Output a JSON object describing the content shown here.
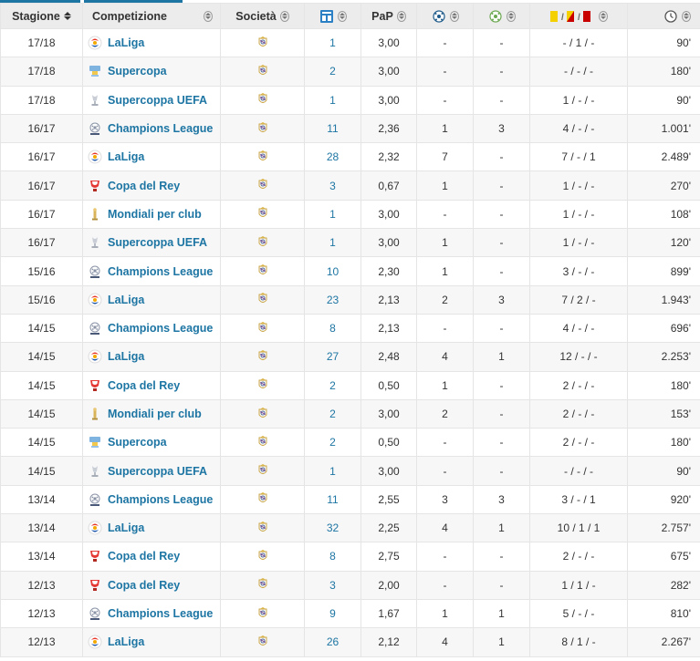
{
  "headers": {
    "season": "Stagione",
    "competition": "Competizione",
    "club": "Società",
    "appearances_icon": "appearances-icon",
    "ppg": "PaP",
    "goals_icon": "goals-icon",
    "assists_icon": "assists-icon",
    "cards_icon": "cards-icon",
    "minutes_icon": "clock-icon"
  },
  "colors": {
    "link": "#1d75a3",
    "header_bg": "#ececec",
    "row_alt": "#f7f7f7",
    "yellow_card": "#f5d000",
    "red_card": "#c90000"
  },
  "rows": [
    {
      "season": "17/18",
      "competition": "LaLiga",
      "icon": "laliga-icon",
      "club_icon": "real-madrid-crest-icon",
      "apps": "1",
      "ppg": "3,00",
      "goals": "-",
      "assists": "-",
      "cards": "- / 1 / -",
      "minutes": "90'"
    },
    {
      "season": "17/18",
      "competition": "Supercopa",
      "icon": "supercopa-icon",
      "club_icon": "real-madrid-crest-icon",
      "apps": "2",
      "ppg": "3,00",
      "goals": "-",
      "assists": "-",
      "cards": "- / - / -",
      "minutes": "180'"
    },
    {
      "season": "17/18",
      "competition": "Supercoppa UEFA",
      "icon": "uefa-supercup-icon",
      "club_icon": "real-madrid-crest-icon",
      "apps": "1",
      "ppg": "3,00",
      "goals": "-",
      "assists": "-",
      "cards": "1 / - / -",
      "minutes": "90'"
    },
    {
      "season": "16/17",
      "competition": "Champions League",
      "icon": "champions-league-icon",
      "club_icon": "real-madrid-crest-icon",
      "apps": "11",
      "ppg": "2,36",
      "goals": "1",
      "assists": "3",
      "cards": "4 / - / -",
      "minutes": "1.001'"
    },
    {
      "season": "16/17",
      "competition": "LaLiga",
      "icon": "laliga-icon",
      "club_icon": "real-madrid-crest-icon",
      "apps": "28",
      "ppg": "2,32",
      "goals": "7",
      "assists": "-",
      "cards": "7 / - / 1",
      "minutes": "2.489'"
    },
    {
      "season": "16/17",
      "competition": "Copa del Rey",
      "icon": "copa-del-rey-icon",
      "club_icon": "real-madrid-crest-icon",
      "apps": "3",
      "ppg": "0,67",
      "goals": "1",
      "assists": "-",
      "cards": "1 / - / -",
      "minutes": "270'"
    },
    {
      "season": "16/17",
      "competition": "Mondiali per club",
      "icon": "club-world-cup-icon",
      "club_icon": "real-madrid-crest-icon",
      "apps": "1",
      "ppg": "3,00",
      "goals": "-",
      "assists": "-",
      "cards": "1 / - / -",
      "minutes": "108'"
    },
    {
      "season": "16/17",
      "competition": "Supercoppa UEFA",
      "icon": "uefa-supercup-icon",
      "club_icon": "real-madrid-crest-icon",
      "apps": "1",
      "ppg": "3,00",
      "goals": "1",
      "assists": "-",
      "cards": "1 / - / -",
      "minutes": "120'"
    },
    {
      "season": "15/16",
      "competition": "Champions League",
      "icon": "champions-league-icon",
      "club_icon": "real-madrid-crest-icon",
      "apps": "10",
      "ppg": "2,30",
      "goals": "1",
      "assists": "-",
      "cards": "3 / - / -",
      "minutes": "899'"
    },
    {
      "season": "15/16",
      "competition": "LaLiga",
      "icon": "laliga-icon",
      "club_icon": "real-madrid-crest-icon",
      "apps": "23",
      "ppg": "2,13",
      "goals": "2",
      "assists": "3",
      "cards": "7 / 2 / -",
      "minutes": "1.943'"
    },
    {
      "season": "14/15",
      "competition": "Champions League",
      "icon": "champions-league-icon",
      "club_icon": "real-madrid-crest-icon",
      "apps": "8",
      "ppg": "2,13",
      "goals": "-",
      "assists": "-",
      "cards": "4 / - / -",
      "minutes": "696'"
    },
    {
      "season": "14/15",
      "competition": "LaLiga",
      "icon": "laliga-icon",
      "club_icon": "real-madrid-crest-icon",
      "apps": "27",
      "ppg": "2,48",
      "goals": "4",
      "assists": "1",
      "cards": "12 / - / -",
      "minutes": "2.253'"
    },
    {
      "season": "14/15",
      "competition": "Copa del Rey",
      "icon": "copa-del-rey-icon",
      "club_icon": "real-madrid-crest-icon",
      "apps": "2",
      "ppg": "0,50",
      "goals": "1",
      "assists": "-",
      "cards": "2 / - / -",
      "minutes": "180'"
    },
    {
      "season": "14/15",
      "competition": "Mondiali per club",
      "icon": "club-world-cup-icon",
      "club_icon": "real-madrid-crest-icon",
      "apps": "2",
      "ppg": "3,00",
      "goals": "2",
      "assists": "-",
      "cards": "2 / - / -",
      "minutes": "153'"
    },
    {
      "season": "14/15",
      "competition": "Supercopa",
      "icon": "supercopa-icon",
      "club_icon": "real-madrid-crest-icon",
      "apps": "2",
      "ppg": "0,50",
      "goals": "-",
      "assists": "-",
      "cards": "2 / - / -",
      "minutes": "180'"
    },
    {
      "season": "14/15",
      "competition": "Supercoppa UEFA",
      "icon": "uefa-supercup-icon",
      "club_icon": "real-madrid-crest-icon",
      "apps": "1",
      "ppg": "3,00",
      "goals": "-",
      "assists": "-",
      "cards": "- / - / -",
      "minutes": "90'"
    },
    {
      "season": "13/14",
      "competition": "Champions League",
      "icon": "champions-league-icon",
      "club_icon": "real-madrid-crest-icon",
      "apps": "11",
      "ppg": "2,55",
      "goals": "3",
      "assists": "3",
      "cards": "3 / - / 1",
      "minutes": "920'"
    },
    {
      "season": "13/14",
      "competition": "LaLiga",
      "icon": "laliga-icon",
      "club_icon": "real-madrid-crest-icon",
      "apps": "32",
      "ppg": "2,25",
      "goals": "4",
      "assists": "1",
      "cards": "10 / 1 / 1",
      "minutes": "2.757'"
    },
    {
      "season": "13/14",
      "competition": "Copa del Rey",
      "icon": "copa-del-rey-icon",
      "club_icon": "real-madrid-crest-icon",
      "apps": "8",
      "ppg": "2,75",
      "goals": "-",
      "assists": "-",
      "cards": "2 / - / -",
      "minutes": "675'"
    },
    {
      "season": "12/13",
      "competition": "Copa del Rey",
      "icon": "copa-del-rey-icon",
      "club_icon": "real-madrid-crest-icon",
      "apps": "3",
      "ppg": "2,00",
      "goals": "-",
      "assists": "-",
      "cards": "1 / 1 / -",
      "minutes": "282'"
    },
    {
      "season": "12/13",
      "competition": "Champions League",
      "icon": "champions-league-icon",
      "club_icon": "real-madrid-crest-icon",
      "apps": "9",
      "ppg": "1,67",
      "goals": "1",
      "assists": "1",
      "cards": "5 / - / -",
      "minutes": "810'"
    },
    {
      "season": "12/13",
      "competition": "LaLiga",
      "icon": "laliga-icon",
      "club_icon": "real-madrid-crest-icon",
      "apps": "26",
      "ppg": "2,12",
      "goals": "4",
      "assists": "1",
      "cards": "8 / 1 / -",
      "minutes": "2.267'"
    }
  ]
}
